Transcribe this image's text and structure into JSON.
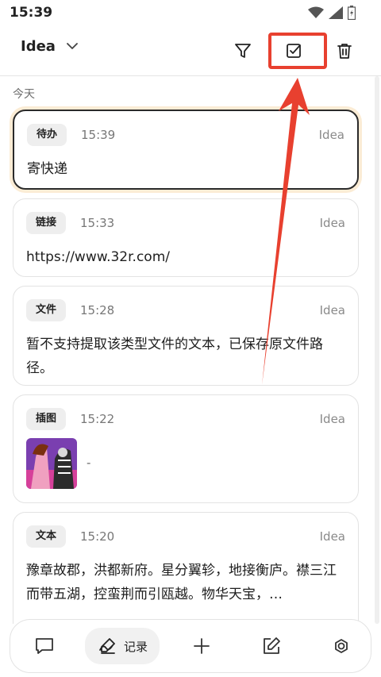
{
  "status_bar": {
    "time": "15:39",
    "icons": [
      "wifi-icon",
      "signal-icon",
      "battery-icon"
    ]
  },
  "header": {
    "title": "Idea",
    "actions": [
      "filter-icon",
      "checkbox-select-icon",
      "trash-icon"
    ]
  },
  "section_label": "今天",
  "cards": [
    {
      "tag": "待办",
      "time": "15:39",
      "source": "Idea",
      "content": "寄快递"
    },
    {
      "tag": "链接",
      "time": "15:33",
      "source": "Idea",
      "content": "https://www.32r.com/"
    },
    {
      "tag": "文件",
      "time": "15:28",
      "source": "Idea",
      "content": "暂不支持提取该类型文件的文本，已保存原文件路径。"
    },
    {
      "tag": "插图",
      "time": "15:22",
      "source": "Idea",
      "caption": "-"
    },
    {
      "tag": "文本",
      "time": "15:20",
      "source": "Idea",
      "content": "豫章故郡，洪都新府。星分翼轸，地接衡庐。襟三江而带五湖，控蛮荆而引瓯越。物华天宝，…"
    }
  ],
  "bottom_nav": {
    "active_label": "记录",
    "items": [
      "chat-icon",
      "record-icon",
      "add-icon",
      "edit-icon",
      "settings-icon"
    ]
  },
  "colors": {
    "accent_red": "#e8402f",
    "selected_glow": "#fbecd5",
    "tag_bg": "#eeeeee"
  }
}
